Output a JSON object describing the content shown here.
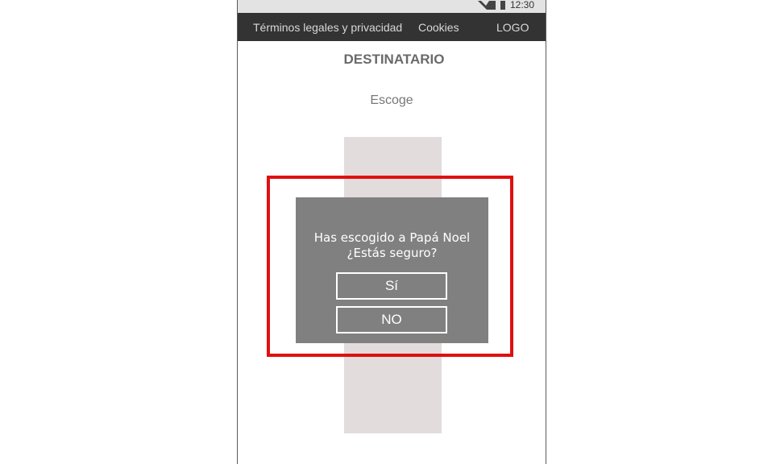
{
  "status_bar": {
    "time": "12:30",
    "icons": [
      "signal-icon",
      "battery-icon"
    ]
  },
  "nav": {
    "items": [
      "Términos legales y privacidad",
      "Cookies",
      "LOGO"
    ]
  },
  "page": {
    "title": "DESTINATARIO",
    "subtitle": "Escoge"
  },
  "dialog": {
    "line1": "Has escogido a Papá Noel",
    "line2": "¿Estás seguro?",
    "yes_label": "Sí",
    "no_label": "NO"
  },
  "colors": {
    "nav_background": "#333333",
    "dialog_background": "#808080",
    "highlight": "#e01010",
    "choice_column": "#e2dcdc"
  }
}
